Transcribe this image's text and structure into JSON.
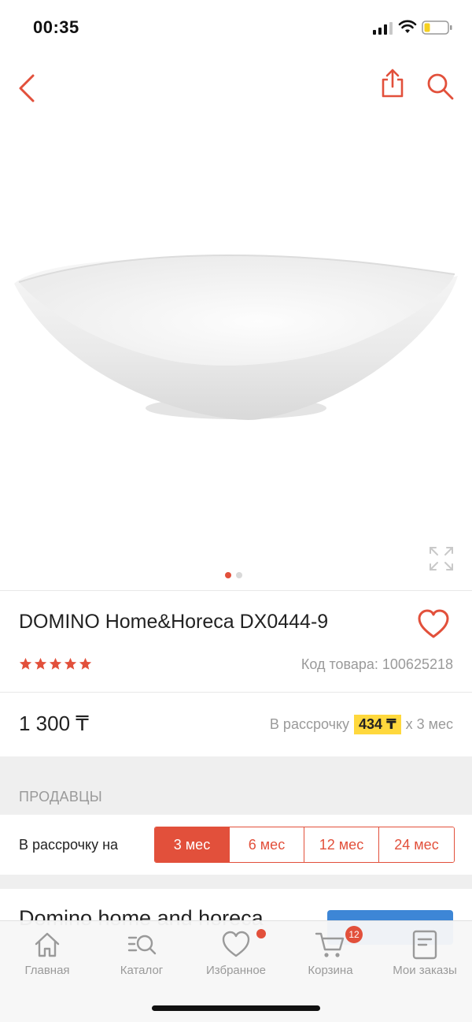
{
  "status_bar": {
    "time": "00:35"
  },
  "colors": {
    "accent": "#e2503b",
    "highlight": "#ffd83d",
    "seller_button": "#3d86d6",
    "muted": "#9a9a9a"
  },
  "nav": {
    "icons": [
      "back-chevron-icon",
      "share-icon",
      "search-icon"
    ]
  },
  "gallery": {
    "image": "white oval porcelain bowl",
    "current": 1,
    "total": 2
  },
  "product": {
    "title": "DOMINO Home&Horeca DX0444-9",
    "rating": 5,
    "sku": "Код товара: 100625218",
    "price": "1 300 ₸",
    "installment_prefix": "В рассрочку",
    "installment_amount": "434 ₸",
    "installment_suffix": "x 3 мес"
  },
  "sellers": {
    "section_label": "ПРОДАВЦЫ",
    "term_label": "В рассрочку на",
    "terms": [
      {
        "label": "3 мес",
        "active": true
      },
      {
        "label": "6 мес",
        "active": false
      },
      {
        "label": "12 мес",
        "active": false
      },
      {
        "label": "24 мес",
        "active": false
      }
    ],
    "first_seller": "Domino home and horeca"
  },
  "tab_bar": {
    "tabs": [
      {
        "label": "Главная",
        "icon": "home-icon"
      },
      {
        "label": "Каталог",
        "icon": "catalog-search-icon"
      },
      {
        "label": "Избранное",
        "icon": "heart-icon"
      },
      {
        "label": "Корзина",
        "icon": "cart-icon"
      },
      {
        "label": "Мои заказы",
        "icon": "orders-icon"
      }
    ],
    "cart_count": "12"
  }
}
